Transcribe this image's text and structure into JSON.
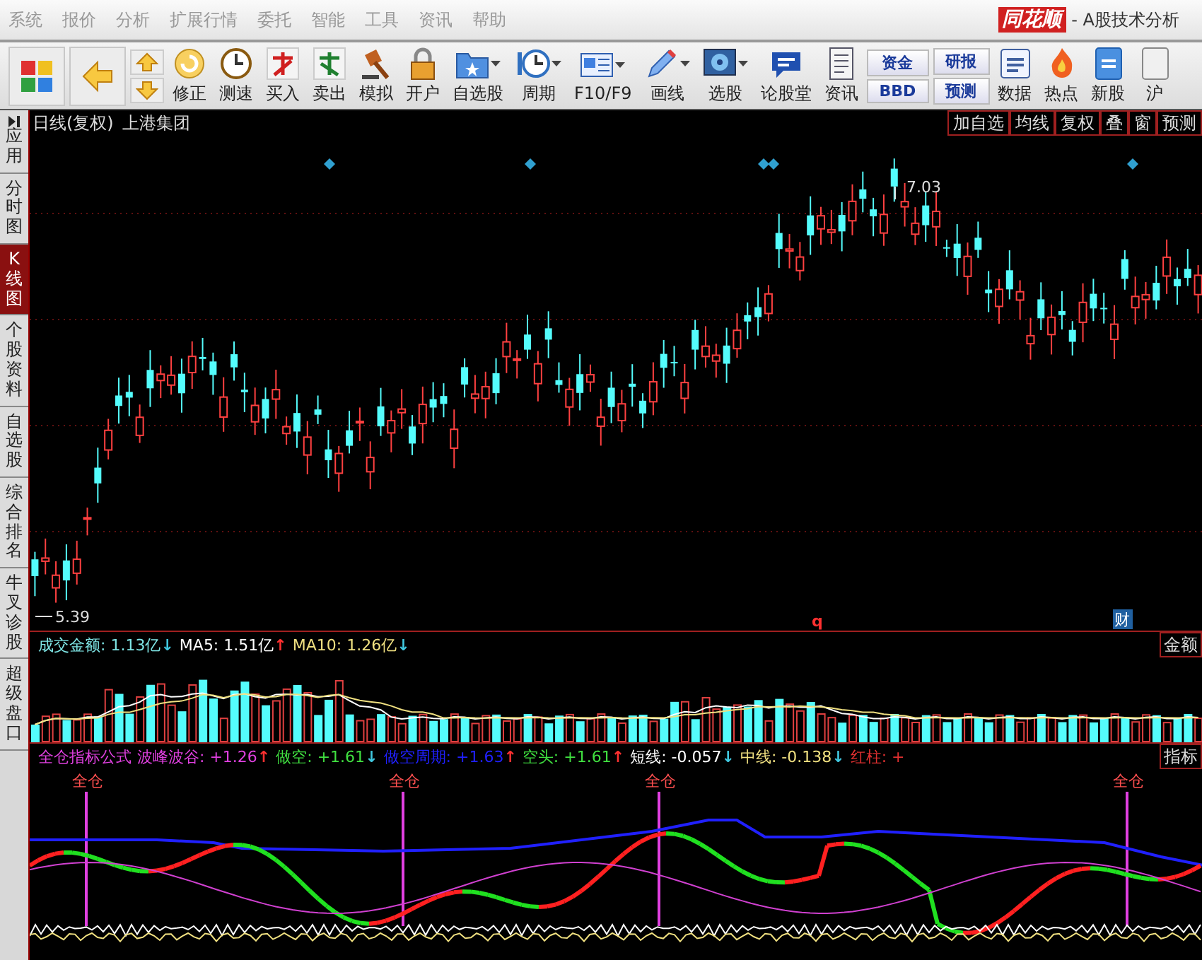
{
  "menu": [
    "系统",
    "报价",
    "分析",
    "扩展行情",
    "委托",
    "智能",
    "工具",
    "资讯",
    "帮助"
  ],
  "title": {
    "logo": "同花顺",
    "text": "- A股技术分析"
  },
  "toolbar": [
    {
      "kind": "icon"
    },
    {
      "kind": "icon"
    },
    {
      "kind": "updown"
    },
    {
      "kind": "button",
      "label": "修正",
      "dropdown": false
    },
    {
      "kind": "button",
      "label": "测速",
      "dropdown": false
    },
    {
      "kind": "button",
      "label": "买入",
      "dropdown": false
    },
    {
      "kind": "button",
      "label": "卖出",
      "dropdown": false
    },
    {
      "kind": "button",
      "label": "模拟",
      "dropdown": false
    },
    {
      "kind": "button",
      "label": "开户",
      "dropdown": false
    },
    {
      "kind": "button",
      "label": "自选股",
      "dropdown": true
    },
    {
      "kind": "button",
      "label": "周期",
      "dropdown": true
    },
    {
      "kind": "button",
      "label": "F10/F9",
      "dropdown": true
    },
    {
      "kind": "button",
      "label": "画线",
      "dropdown": true
    },
    {
      "kind": "button",
      "label": "选股",
      "dropdown": true
    },
    {
      "kind": "button",
      "label": "论股堂",
      "dropdown": false
    },
    {
      "kind": "button",
      "label": "资讯",
      "dropdown": false
    },
    {
      "kind": "stack",
      "labels": [
        "资金",
        "BBD"
      ]
    },
    {
      "kind": "stack",
      "labels": [
        "研报",
        "预测"
      ]
    },
    {
      "kind": "button",
      "label": "数据",
      "dropdown": false
    },
    {
      "kind": "button",
      "label": "热点",
      "dropdown": false
    },
    {
      "kind": "button",
      "label": "新股",
      "dropdown": false
    },
    {
      "kind": "button",
      "label": "沪",
      "dropdown": false
    }
  ],
  "sidebar": [
    {
      "label": "应用",
      "selected": false
    },
    {
      "label": "分时图",
      "selected": false
    },
    {
      "label": "K线图",
      "selected": true
    },
    {
      "label": "个股资料",
      "selected": false
    },
    {
      "label": "自选股",
      "selected": false
    },
    {
      "label": "综合排名",
      "selected": false
    },
    {
      "label": "牛叉诊股",
      "selected": false
    },
    {
      "label": "超级盘口",
      "selected": false
    }
  ],
  "chart_header": {
    "period": "日线(复权)",
    "stock": "上港集团",
    "buttons": [
      "加自选",
      "均线",
      "复权",
      "叠",
      "窗",
      "预测"
    ]
  },
  "price_labels": {
    "high": "7.03",
    "low": "5.39"
  },
  "event_marks": [
    {
      "kind": "q",
      "label": "q"
    },
    {
      "kind": "finance",
      "label": "财"
    }
  ],
  "volume_panel": {
    "readouts": [
      {
        "text": "成交金额: 1.13亿",
        "arrow": {
          "text": "↓",
          "color": "#40c8e0"
        },
        "color": "#7fe6e6"
      },
      {
        "text": "MA5: 1.51亿",
        "arrow": {
          "text": "↑",
          "color": "#ff3030"
        },
        "color": "#ffffff"
      },
      {
        "text": "MA10: 1.26亿",
        "arrow": {
          "text": "↓",
          "color": "#40c8e0"
        },
        "color": "#f0e080"
      }
    ],
    "tab": "金额"
  },
  "indicator_panel": {
    "readouts": [
      {
        "text": "全仓指标公式",
        "color": "#e040e0"
      },
      {
        "text": "波峰波谷: +1.26",
        "arrow": {
          "text": "↑",
          "color": "#ff3030"
        },
        "color": "#e040e0"
      },
      {
        "text": "做空: +1.61",
        "arrow": {
          "text": "↓",
          "color": "#40c8e0"
        },
        "color": "#40e040"
      },
      {
        "text": "做空周期: +1.63",
        "arrow": {
          "text": "↑",
          "color": "#ff3030"
        },
        "color": "#2020ff"
      },
      {
        "text": "空头: +1.61",
        "arrow": {
          "text": "↑",
          "color": "#ff3030"
        },
        "color": "#40e040"
      },
      {
        "text": "短线: -0.057",
        "arrow": {
          "text": "↓",
          "color": "#40c8e0"
        },
        "color": "#ffffff"
      },
      {
        "text": "中线: -0.138",
        "arrow": {
          "text": "↓",
          "color": "#40c8e0"
        },
        "color": "#f0e080"
      },
      {
        "text": "红柱: +",
        "color": "#e03030"
      }
    ],
    "tab": "指标",
    "signals": [
      "全仓",
      "全仓",
      "全仓",
      "全仓"
    ]
  }
}
